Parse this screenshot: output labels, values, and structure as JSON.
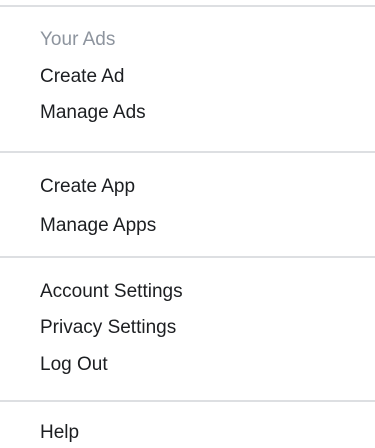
{
  "menu": {
    "sections": [
      {
        "header": "Your Ads",
        "items": [
          "Create Ad",
          "Manage Ads"
        ]
      },
      {
        "items": [
          "Create App",
          "Manage Apps"
        ]
      },
      {
        "items": [
          "Account Settings",
          "Privacy Settings",
          "Log Out"
        ]
      },
      {
        "items": [
          "Help"
        ]
      }
    ]
  },
  "colors": {
    "text": "#1c1e21",
    "header_text": "#8d949e",
    "divider": "#dddfe2",
    "background": "#ffffff"
  }
}
